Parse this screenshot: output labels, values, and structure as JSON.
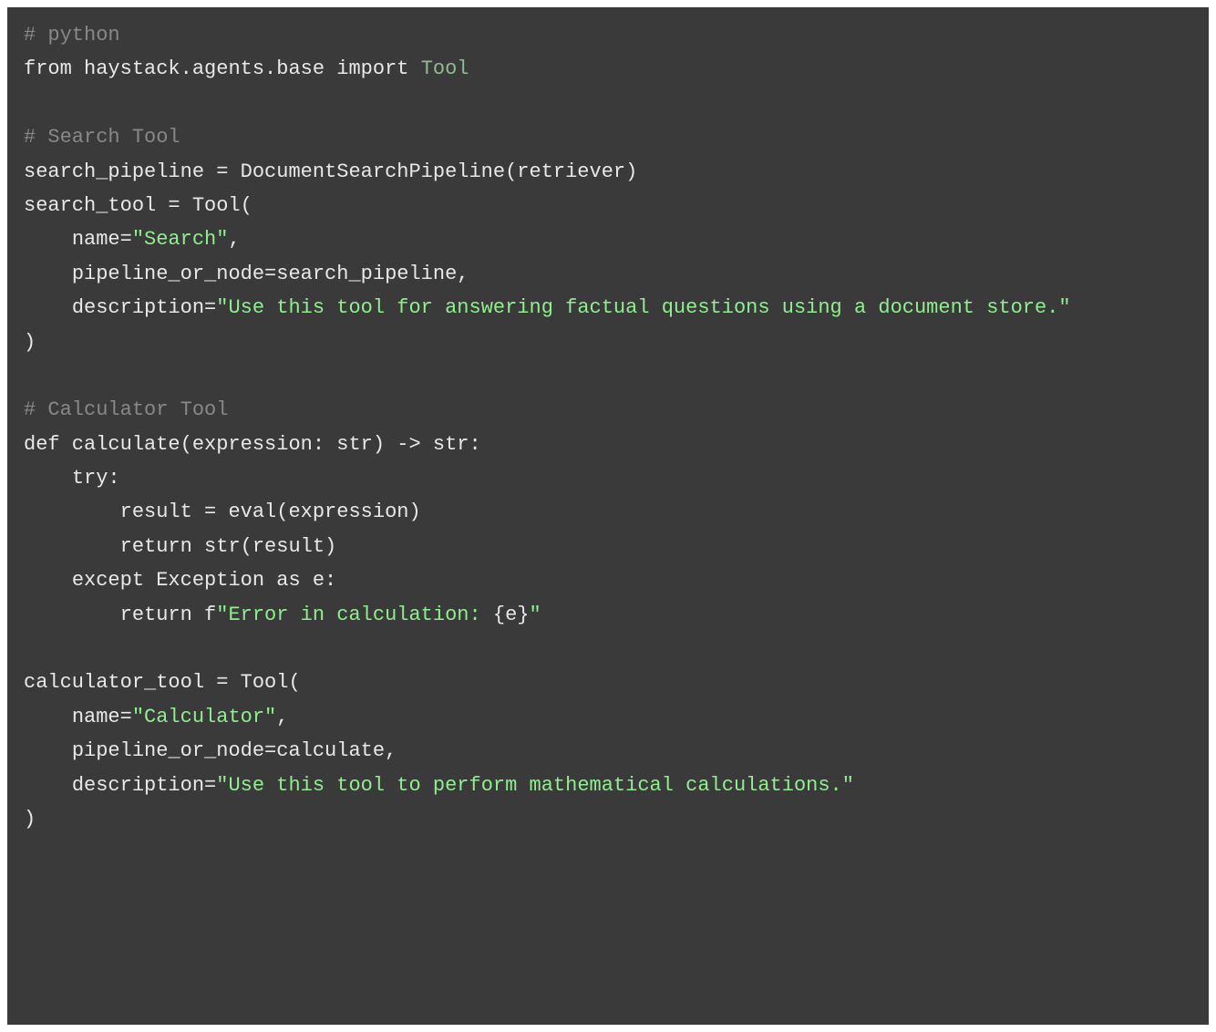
{
  "code": {
    "l1_comment": "# python",
    "l2_from": "from",
    "l2_module": " haystack.agents.base ",
    "l2_import": "import",
    "l2_space": " ",
    "l2_class": "Tool",
    "l4_comment": "# Search Tool",
    "l5": "search_pipeline = DocumentSearchPipeline(retriever)",
    "l6": "search_tool = Tool(",
    "l7_pre": "    name=",
    "l7_str": "\"Search\"",
    "l7_post": ",",
    "l8": "    pipeline_or_node=search_pipeline,",
    "l9_pre": "    description=",
    "l9_str": "\"Use this tool for answering factual questions using a document store.\"",
    "l10": ")",
    "l12_comment": "# Calculator Tool",
    "l13": "def calculate(expression: str) -> str:",
    "l14": "    try:",
    "l15": "        result = eval(expression)",
    "l16": "        return str(result)",
    "l17": "    except Exception as e:",
    "l18_pre": "        return f",
    "l18_str1": "\"Error in calculation: ",
    "l18_brace": "{e}",
    "l18_str2": "\"",
    "l20": "calculator_tool = Tool(",
    "l21_pre": "    name=",
    "l21_str": "\"Calculator\"",
    "l21_post": ",",
    "l22": "    pipeline_or_node=calculate,",
    "l23_pre": "    description=",
    "l23_str": "\"Use this tool to perform mathematical calculations.\"",
    "l24": ")"
  }
}
